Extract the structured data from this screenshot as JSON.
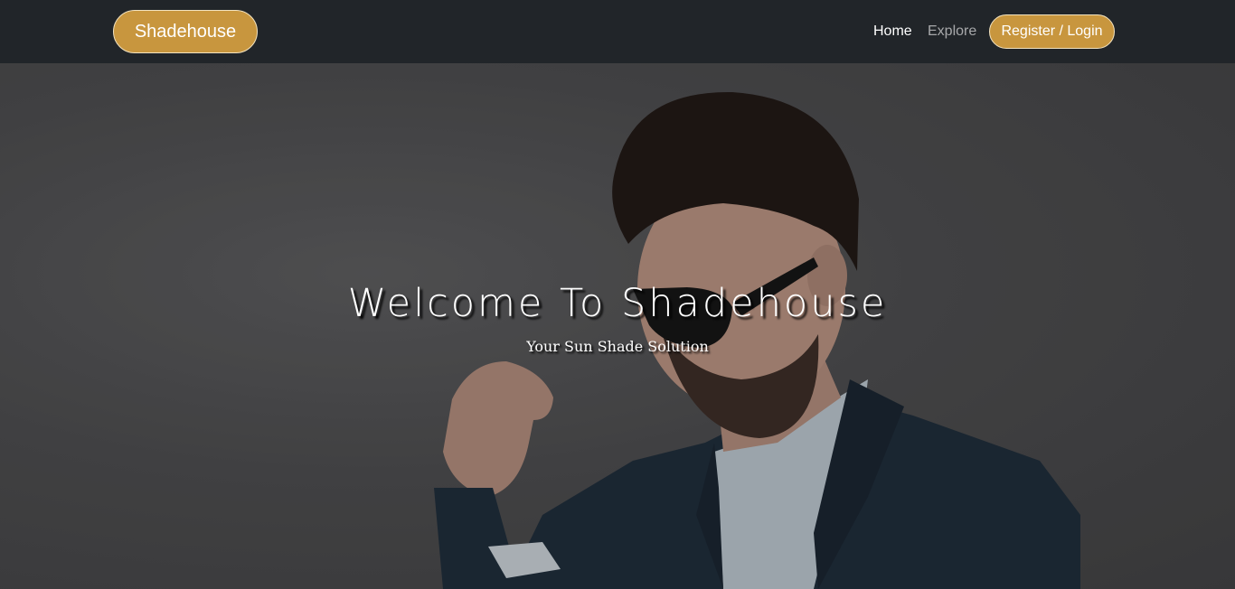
{
  "navbar": {
    "brand": "Shadehouse",
    "links": [
      {
        "label": "Home",
        "active": true
      },
      {
        "label": "Explore",
        "active": false
      }
    ],
    "login_label": "Register / Login"
  },
  "hero": {
    "title": "Welcome To Shadehouse",
    "subtitle": "Your Sun Shade Solution",
    "image_description": "man-in-sunglasses-and-suit-icon"
  },
  "colors": {
    "navbar_bg": "#212529",
    "accent": "#c8963e",
    "accent_border": "#f3e3c0",
    "text": "#ffffff"
  }
}
